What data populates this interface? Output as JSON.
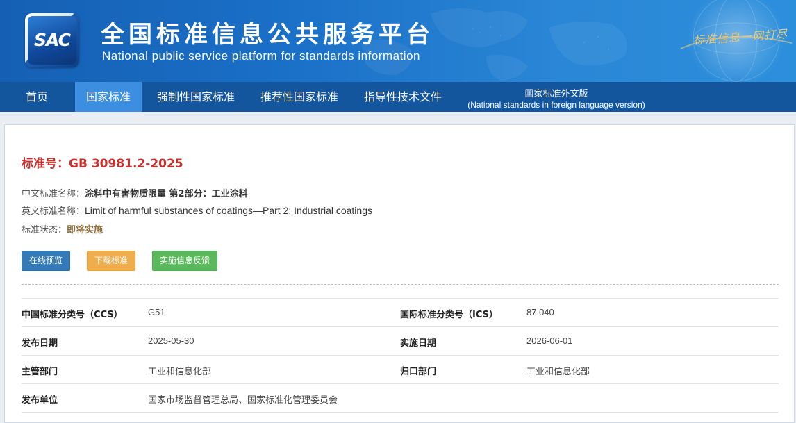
{
  "header": {
    "logo_text": "SAC",
    "title": "全国标准信息公共服务平台",
    "subtitle": "National public service platform  for standards information",
    "slogan": "标准信息一网打尽"
  },
  "nav": {
    "items": [
      {
        "label": "首页"
      },
      {
        "label": "国家标准",
        "active": true
      },
      {
        "label": "强制性国家标准"
      },
      {
        "label": "推荐性国家标准"
      },
      {
        "label": "指导性技术文件"
      }
    ],
    "foreign": {
      "line1": "国家标准外文版",
      "line2": "(National standards in foreign language version)"
    }
  },
  "standard": {
    "number_label": "标准号：",
    "number": "GB 30981.2-2025",
    "cn_name_label": "中文标准名称：",
    "cn_name": "涂料中有害物质限量 第2部分：工业涂料",
    "en_name_label": "英文标准名称：",
    "en_name": "Limit of harmful substances of coatings—Part 2: Industrial coatings",
    "status_label": "标准状态：",
    "status": "即将实施"
  },
  "buttons": {
    "preview": "在线预览",
    "download": "下载标准",
    "feedback": "实施信息反馈"
  },
  "details": {
    "ccs_label": "中国标准分类号（CCS）",
    "ccs": "G51",
    "ics_label": "国际标准分类号（ICS）",
    "ics": "87.040",
    "publish_date_label": "发布日期",
    "publish_date": "2025-05-30",
    "implement_date_label": "实施日期",
    "implement_date": "2026-06-01",
    "competent_label": "主管部门",
    "competent": "工业和信息化部",
    "centralized_label": "归口部门",
    "centralized": "工业和信息化部",
    "issuer_label": "发布单位",
    "issuer": "国家市场监督管理总局、国家标准化管理委员会"
  },
  "colors": {
    "nav_bg": "#13569e",
    "nav_active": "#3b8ee0",
    "std_number": "#c9302c",
    "btn_primary": "#337ab7",
    "btn_warning": "#f0ad4e",
    "btn_success": "#5cb85c"
  }
}
